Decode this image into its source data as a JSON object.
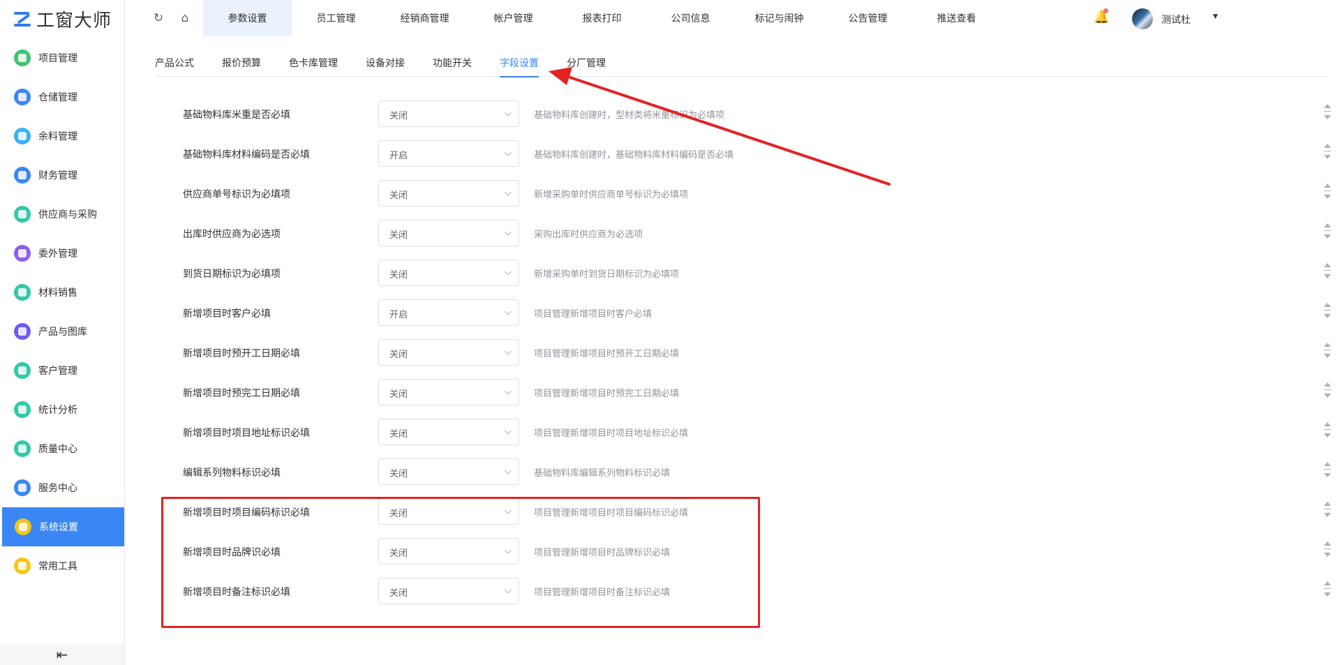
{
  "app": {
    "logo_text": "工窗大师"
  },
  "sidebar": {
    "items": [
      {
        "label": "项目管理",
        "icon": "puzzle-icon",
        "color": "#3ec46d"
      },
      {
        "label": "仓储管理",
        "icon": "layers-icon",
        "color": "#3b86f5"
      },
      {
        "label": "余料管理",
        "icon": "box-icon",
        "color": "#38b2f5"
      },
      {
        "label": "财务管理",
        "icon": "finance-icon",
        "color": "#3b86f5"
      },
      {
        "label": "供应商与采购",
        "icon": "supplier-icon",
        "color": "#2fc9a8"
      },
      {
        "label": "委外管理",
        "icon": "outsource-icon",
        "color": "#8e5cf0"
      },
      {
        "label": "材料销售",
        "icon": "sales-icon",
        "color": "#2fc9a8"
      },
      {
        "label": "产品与图库",
        "icon": "gallery-icon",
        "color": "#6c5cf0"
      },
      {
        "label": "客户管理",
        "icon": "user-icon",
        "color": "#2fc9a8"
      },
      {
        "label": "统计分析",
        "icon": "chart-icon",
        "color": "#2fc9a8"
      },
      {
        "label": "质量中心",
        "icon": "flask-icon",
        "color": "#2fc9a8"
      },
      {
        "label": "服务中心",
        "icon": "phone-icon",
        "color": "#3b86f5"
      },
      {
        "label": "系统设置",
        "icon": "settings-icon",
        "color": "#f5c518",
        "active": true
      },
      {
        "label": "常用工具",
        "icon": "help-icon",
        "color": "#f5c518"
      }
    ],
    "collapse_glyph": "⇤"
  },
  "topbar": {
    "refresh_glyph": "↻",
    "home_glyph": "⌂",
    "tabs": [
      {
        "label": "参数设置",
        "active": true
      },
      {
        "label": "员工管理"
      },
      {
        "label": "经销商管理"
      },
      {
        "label": "帐户管理"
      },
      {
        "label": "报表打印"
      },
      {
        "label": "公司信息"
      },
      {
        "label": "标记与闹钟"
      },
      {
        "label": "公告管理"
      },
      {
        "label": "推送查看"
      }
    ],
    "bell_glyph": "🔔",
    "user_name": "测试杜",
    "caret": "▼"
  },
  "subtabs": [
    {
      "label": "产品公式"
    },
    {
      "label": "报价预算"
    },
    {
      "label": "色卡库管理"
    },
    {
      "label": "设备对接"
    },
    {
      "label": "功能开关"
    },
    {
      "label": "字段设置",
      "active": true
    },
    {
      "label": "分厂管理"
    }
  ],
  "settings": [
    {
      "label": "基础物料库米重是否必填",
      "value": "关闭",
      "desc": "基础物料库创建时，型材类将米重标识为必填项"
    },
    {
      "label": "基础物料库材料编码是否必填",
      "value": "开启",
      "desc": "基础物料库创建时，基础物料库材料编码是否必填"
    },
    {
      "label": "供应商单号标识为必填项",
      "value": "关闭",
      "desc": "新增采购单时供应商单号标识为必填项"
    },
    {
      "label": "出库时供应商为必选项",
      "value": "关闭",
      "desc": "采购出库时供应商为必选项"
    },
    {
      "label": "到货日期标识为必填项",
      "value": "关闭",
      "desc": "新增采购单时到货日期标识为必填项"
    },
    {
      "label": "新增项目时客户必填",
      "value": "开启",
      "desc": "项目管理新增项目时客户必填"
    },
    {
      "label": "新增项目时预开工日期必填",
      "value": "关闭",
      "desc": "项目管理新增项目时预开工日期必填"
    },
    {
      "label": "新增项目时预完工日期必填",
      "value": "关闭",
      "desc": "项目管理新增项目时预完工日期必填"
    },
    {
      "label": "新增项目时项目地址标识必填",
      "value": "关闭",
      "desc": "项目管理新增项目时项目地址标识必填"
    },
    {
      "label": "编辑系列物料标识必填",
      "value": "关闭",
      "desc": "基础物料库编辑系列物料标识必填"
    },
    {
      "label": "新增项目时项目编码标识必填",
      "value": "关闭",
      "desc": "项目管理新增项目时项目编码标识必填"
    },
    {
      "label": "新增项目时品牌识必填",
      "value": "关闭",
      "desc": "项目管理新增项目时品牌标识必填"
    },
    {
      "label": "新增项目时备注标识必填",
      "value": "关闭",
      "desc": "项目管理新增项目时备注标识必填"
    }
  ],
  "colors": {
    "accent": "#3b86f5",
    "annotation": "#e32222"
  }
}
